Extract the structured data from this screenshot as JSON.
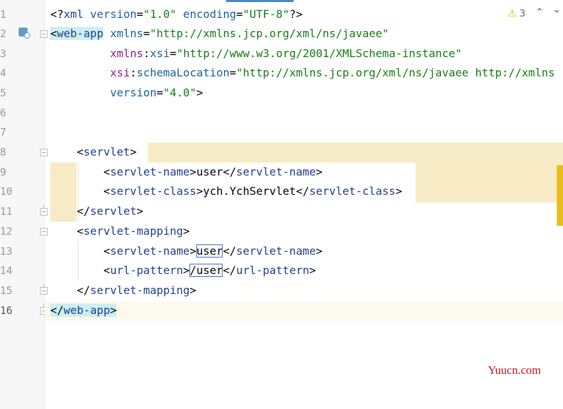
{
  "inspections": {
    "warning_count": "3",
    "warning_icon": "warning-triangle-icon"
  },
  "navigation": {
    "up_glyph": "⌃",
    "down_glyph": "⌄"
  },
  "line_numbers": [
    "1",
    "2",
    "3",
    "4",
    "5",
    "6",
    "7",
    "8",
    "9",
    "10",
    "11",
    "12",
    "13",
    "14",
    "15",
    "16"
  ],
  "code": {
    "l1": {
      "open": "<?",
      "name": "xml",
      "a1": " version",
      "eq1": "=",
      "v1": "\"1.0\"",
      "a2": " encoding",
      "eq2": "=",
      "v2": "\"UTF-8\"",
      "close": "?>"
    },
    "l2": {
      "lt": "<",
      "tag": "web-app",
      "attr": " xmlns",
      "eq": "=",
      "val": "\"http://xmlns.jcp.org/xml/ns/javaee\""
    },
    "l3": {
      "indent": "         ",
      "ns": "xmlns",
      "colon": ":",
      "attr": "xsi",
      "eq": "=",
      "val": "\"http://www.w3.org/2001/XMLSchema-instance\""
    },
    "l4": {
      "indent": "         ",
      "ns": "xsi",
      "colon": ":",
      "attr": "schemaLocation",
      "eq": "=",
      "val": "\"http://xmlns.jcp.org/xml/ns/javaee http://xmlns"
    },
    "l5": {
      "indent": "         ",
      "attr": "version",
      "eq": "=",
      "val": "\"4.0\"",
      "close": ">"
    },
    "l8": {
      "indent": "    ",
      "lt": "<",
      "tag": "servlet",
      "gt": ">"
    },
    "l9": {
      "indent": "        ",
      "lt": "<",
      "tag": "servlet-name",
      "gt": ">",
      "text": "user",
      "clt": "</",
      "ctag": "servlet-name",
      "cgt": ">"
    },
    "l10": {
      "indent": "        ",
      "lt": "<",
      "tag": "servlet-class",
      "gt": ">",
      "text": "ych.YchServlet",
      "clt": "</",
      "ctag": "servlet-class",
      "cgt": ">"
    },
    "l11": {
      "indent": "    ",
      "lt": "</",
      "tag": "servlet",
      "gt": ">"
    },
    "l12": {
      "indent": "    ",
      "lt": "<",
      "tag": "servlet-mapping",
      "gt": ">"
    },
    "l13": {
      "indent": "        ",
      "lt": "<",
      "tag": "servlet-name",
      "gt": ">",
      "text": "user",
      "clt": "</",
      "ctag": "servlet-name",
      "cgt": ">"
    },
    "l14": {
      "indent": "        ",
      "lt": "<",
      "tag": "url-pattern",
      "gt": ">",
      "text": "/user",
      "clt": "</",
      "ctag": "url-pattern",
      "cgt": ">"
    },
    "l15": {
      "indent": "    ",
      "lt": "</",
      "tag": "servlet-mapping",
      "gt": ">"
    },
    "l16": {
      "lt": "</",
      "tag": "web-app",
      "gt": ">"
    }
  },
  "watermark": "Yuucn.com",
  "colors": {
    "tag": "#1c3d8c",
    "attribute": "#175d9e",
    "namespace": "#8c1d8f",
    "string": "#137b13",
    "highlight": "#f6ebc4",
    "tag_match": "#cdeef0",
    "warning": "#e8a800"
  }
}
